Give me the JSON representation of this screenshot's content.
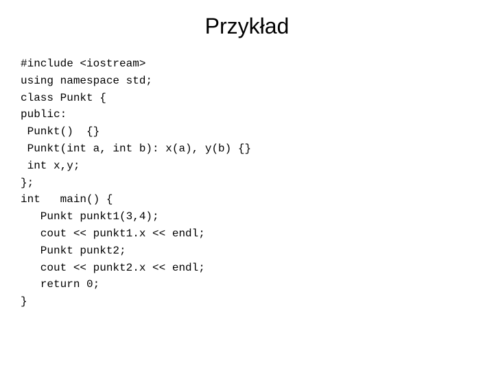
{
  "title": "Przykład",
  "code": {
    "lines": [
      "#include <iostream>",
      "using namespace std;",
      "class Punkt {",
      "public:",
      " Punkt()  {}",
      " Punkt(int a, int b): x(a), y(b) {}",
      " int x,y;",
      "};",
      "int   main() {",
      "   Punkt punkt1(3,4);",
      "   cout << punkt1.x << endl;",
      "   Punkt punkt2;",
      "   cout << punkt2.x << endl;",
      "   return 0;",
      "}"
    ]
  }
}
